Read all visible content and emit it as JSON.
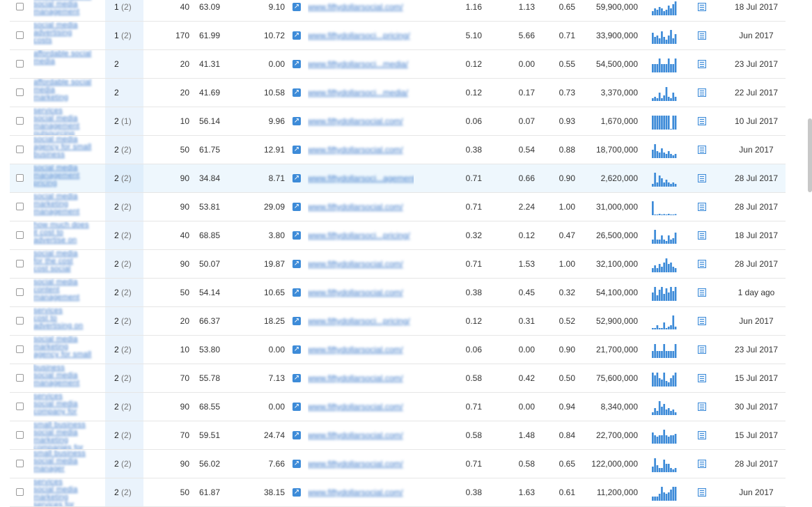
{
  "colors": {
    "link": "#3a78c9",
    "accent": "#3d8bd8",
    "position_bg": "#eaf3fc",
    "highlight_row": "#eef7fd"
  },
  "icons": {
    "external_link": "external-link-icon",
    "serp": "serp-snapshot-icon"
  },
  "rows": [
    {
      "kw": [
        "affordable social",
        "social media",
        "management"
      ],
      "pos": "1",
      "prev": "(2)",
      "vol": "40",
      "kd": "63.09",
      "cpc": "9.10",
      "url": "www.fiftydollarsocial.com/",
      "c1": "1.16",
      "c2": "1.13",
      "c3": "0.65",
      "results": "59,900,000",
      "trend": [
        0.3,
        0.5,
        0.4,
        0.6,
        0.5,
        0.3,
        0.4,
        0.7,
        0.5,
        0.8,
        1
      ],
      "date": "18 Jul 2017"
    },
    {
      "kw": [
        "social media",
        "advertising",
        "costs"
      ],
      "pos": "1",
      "prev": "(2)",
      "vol": "170",
      "kd": "61.99",
      "cpc": "10.72",
      "url": "www.fiftydollarsoci...pricing/",
      "c1": "5.10",
      "c2": "5.66",
      "c3": "0.71",
      "results": "33,900,000",
      "trend": [
        0.8,
        0.5,
        0.6,
        0.4,
        0.9,
        0.5,
        0.3,
        0.6,
        1,
        0.4,
        0.7
      ],
      "date": "Jun 2017"
    },
    {
      "kw": [
        "affordable social",
        "media"
      ],
      "pos": "2",
      "prev": "",
      "vol": "20",
      "kd": "41.31",
      "cpc": "0.00",
      "url": "www.fiftydollarsoci...media/",
      "c1": "0.12",
      "c2": "0.00",
      "c3": "0.55",
      "results": "54,500,000",
      "trend": [
        0.6,
        0.6,
        0.6,
        1,
        0.6,
        0.6,
        0.6,
        1,
        0.6,
        0.6,
        1
      ],
      "date": "23 Jul 2017"
    },
    {
      "kw": [
        "affordable social",
        "media",
        "marketing"
      ],
      "pos": "2",
      "prev": "",
      "vol": "20",
      "kd": "41.69",
      "cpc": "10.58",
      "url": "www.fiftydollarsoci...media/",
      "c1": "0.12",
      "c2": "0.17",
      "c3": "0.73",
      "results": "3,370,000",
      "trend": [
        0.2,
        0.3,
        0.2,
        0.6,
        0.2,
        0.4,
        1,
        0.3,
        0.2,
        0.6,
        0.3
      ],
      "date": "22 Jul 2017"
    },
    {
      "kw": [
        "services",
        "social media",
        "management",
        "outsourcing"
      ],
      "pos": "2",
      "prev": "(1)",
      "vol": "10",
      "kd": "56.14",
      "cpc": "9.96",
      "url": "www.fiftydollarsocial.com/",
      "c1": "0.06",
      "c2": "0.07",
      "c3": "0.93",
      "results": "1,670,000",
      "trend": [
        1,
        1,
        1,
        1,
        1,
        1,
        1,
        1,
        0,
        1,
        1
      ],
      "date": "10 Jul 2017"
    },
    {
      "kw": [
        "social media",
        "agency for small",
        "business"
      ],
      "pos": "2",
      "prev": "(2)",
      "vol": "50",
      "kd": "61.75",
      "cpc": "12.91",
      "url": "www.fiftydollarsocial.com/",
      "c1": "0.38",
      "c2": "0.54",
      "c3": "0.88",
      "results": "18,700,000",
      "trend": [
        0.6,
        1,
        0.5,
        0.4,
        0.7,
        0.4,
        0.3,
        0.5,
        0.3,
        0.2,
        0.3
      ],
      "date": "Jun 2017"
    },
    {
      "kw": [
        "social media",
        "management",
        "pricing"
      ],
      "pos": "2",
      "prev": "(2)",
      "vol": "90",
      "kd": "34.84",
      "cpc": "8.71",
      "url": "www.fiftydollarsoci...agement/",
      "c1": "0.71",
      "c2": "0.66",
      "c3": "0.90",
      "results": "2,620,000",
      "trend": [
        0.2,
        1,
        0.3,
        0.8,
        0.6,
        0.3,
        0.5,
        0.3,
        0.2,
        0.3,
        0.2
      ],
      "date": "28 Jul 2017",
      "hl": true
    },
    {
      "kw": [
        "social media",
        "marketing",
        "management"
      ],
      "pos": "2",
      "prev": "(2)",
      "vol": "90",
      "kd": "53.81",
      "cpc": "29.09",
      "url": "www.fiftydollarsocial.com/",
      "c1": "0.71",
      "c2": "2.24",
      "c3": "1.00",
      "results": "31,000,000",
      "trend": [
        1,
        0.05,
        0.05,
        0.1,
        0.05,
        0.08,
        0.05,
        0.1,
        0.05,
        0.05,
        0.08
      ],
      "date": "28 Jul 2017"
    },
    {
      "kw": [
        "how much does",
        "it cost to",
        "advertise on"
      ],
      "pos": "2",
      "prev": "(2)",
      "vol": "40",
      "kd": "68.85",
      "cpc": "3.80",
      "url": "www.fiftydollarsoci...pricing/",
      "c1": "0.32",
      "c2": "0.12",
      "c3": "0.47",
      "results": "26,500,000",
      "trend": [
        0.3,
        1,
        0.3,
        0.3,
        0.6,
        0.3,
        0.2,
        0.6,
        0.3,
        0.4,
        0.8
      ],
      "date": "18 Jul 2017"
    },
    {
      "kw": [
        "social media",
        "for the cost",
        "cost social"
      ],
      "pos": "2",
      "prev": "(2)",
      "vol": "90",
      "kd": "50.07",
      "cpc": "19.87",
      "url": "www.fiftydollarsocial.com/",
      "c1": "0.71",
      "c2": "1.53",
      "c3": "1.00",
      "results": "32,100,000",
      "trend": [
        0.3,
        0.5,
        0.3,
        0.6,
        0.4,
        0.7,
        1,
        0.6,
        0.7,
        0.4,
        0.3
      ],
      "date": "28 Jul 2017"
    },
    {
      "kw": [
        "social media",
        "content",
        "management"
      ],
      "pos": "2",
      "prev": "(2)",
      "vol": "50",
      "kd": "54.14",
      "cpc": "10.65",
      "url": "www.fiftydollarsocial.com/",
      "c1": "0.38",
      "c2": "0.45",
      "c3": "0.32",
      "results": "54,100,000",
      "trend": [
        0.6,
        1,
        0.4,
        0.8,
        1,
        0.5,
        0.9,
        0.6,
        1,
        0.7,
        1
      ],
      "date": "1 day ago"
    },
    {
      "kw": [
        "services",
        "cost to",
        "advertising on"
      ],
      "pos": "2",
      "prev": "(2)",
      "vol": "20",
      "kd": "66.37",
      "cpc": "18.25",
      "url": "www.fiftydollarsoci...pricing/",
      "c1": "0.12",
      "c2": "0.31",
      "c3": "0.52",
      "results": "52,900,000",
      "trend": [
        0.1,
        0.1,
        0.3,
        0.1,
        0.1,
        0.5,
        0.1,
        0.2,
        0.3,
        1,
        0.2
      ],
      "date": "Jun 2017"
    },
    {
      "kw": [
        "social media",
        "marketing",
        "agency for small"
      ],
      "pos": "2",
      "prev": "(2)",
      "vol": "10",
      "kd": "53.80",
      "cpc": "0.00",
      "url": "www.fiftydollarsocial.com/",
      "c1": "0.06",
      "c2": "0.00",
      "c3": "0.90",
      "results": "21,700,000",
      "trend": [
        0.5,
        1,
        0.5,
        0.5,
        0.5,
        1,
        0.5,
        0.5,
        0.5,
        0.5,
        1
      ],
      "date": "23 Jul 2017"
    },
    {
      "kw": [
        "business",
        "social media",
        "management"
      ],
      "pos": "2",
      "prev": "(2)",
      "vol": "70",
      "kd": "55.78",
      "cpc": "7.13",
      "url": "www.fiftydollarsocial.com/",
      "c1": "0.58",
      "c2": "0.42",
      "c3": "0.50",
      "results": "75,600,000",
      "trend": [
        1,
        0.8,
        1,
        0.6,
        0.5,
        1,
        0.4,
        0.3,
        0.6,
        0.8,
        1
      ],
      "date": "15 Jul 2017"
    },
    {
      "kw": [
        "services",
        "social media",
        "company for"
      ],
      "pos": "2",
      "prev": "(2)",
      "vol": "90",
      "kd": "68.55",
      "cpc": "0.00",
      "url": "www.fiftydollarsocial.com/",
      "c1": "0.71",
      "c2": "0.00",
      "c3": "0.94",
      "results": "8,340,000",
      "trend": [
        0.2,
        0.5,
        0.3,
        1,
        0.6,
        0.8,
        0.4,
        0.5,
        0.3,
        0.4,
        0.2
      ],
      "date": "30 Jul 2017"
    },
    {
      "kw": [
        "small business",
        "social media",
        "marketing",
        "companies for"
      ],
      "pos": "2",
      "prev": "(2)",
      "vol": "70",
      "kd": "59.51",
      "cpc": "24.74",
      "url": "www.fiftydollarsocial.com/",
      "c1": "0.58",
      "c2": "1.48",
      "c3": "0.84",
      "results": "22,700,000",
      "trend": [
        0.8,
        0.6,
        0.5,
        0.6,
        0.6,
        1,
        0.6,
        0.5,
        0.6,
        0.6,
        0.7
      ],
      "date": "15 Jul 2017"
    },
    {
      "kw": [
        "small business",
        "social media",
        "manager"
      ],
      "pos": "2",
      "prev": "(2)",
      "vol": "90",
      "kd": "56.02",
      "cpc": "7.66",
      "url": "www.fiftydollarsocial.com/",
      "c1": "0.71",
      "c2": "0.58",
      "c3": "0.65",
      "results": "122,000,000",
      "trend": [
        0.4,
        1,
        0.5,
        0.3,
        0.3,
        0.9,
        0.6,
        0.6,
        0.3,
        0.2,
        0.3
      ],
      "date": "28 Jul 2017"
    },
    {
      "kw": [
        "services",
        "social media",
        "marketing",
        "services for"
      ],
      "pos": "2",
      "prev": "(2)",
      "vol": "50",
      "kd": "61.87",
      "cpc": "38.15",
      "url": "www.fiftydollarsocial.com/",
      "c1": "0.38",
      "c2": "1.63",
      "c3": "0.61",
      "results": "11,200,000",
      "trend": [
        0.3,
        0.3,
        0.3,
        0.5,
        1,
        0.6,
        0.5,
        0.6,
        0.8,
        1,
        1
      ],
      "date": "Jun 2017"
    }
  ]
}
